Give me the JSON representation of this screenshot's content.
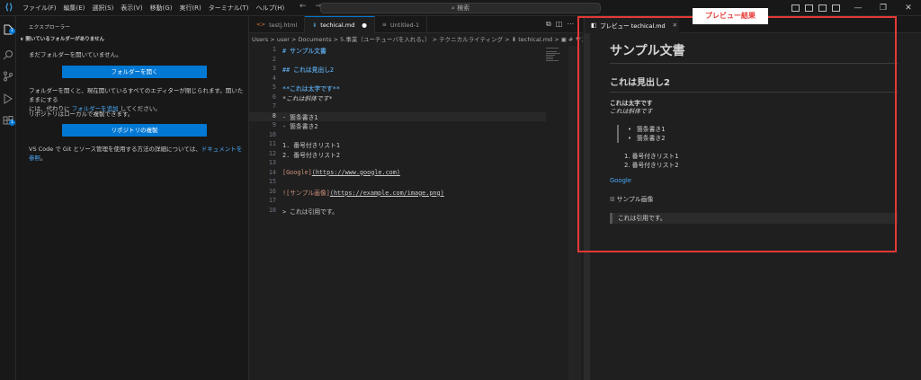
{
  "titlebar": {
    "menu": [
      "ファイル(F)",
      "編集(E)",
      "選択(S)",
      "表示(V)",
      "移動(G)",
      "実行(R)",
      "ターミナル(T)",
      "ヘルプ(H)"
    ],
    "search_placeholder": "検索"
  },
  "sidebar": {
    "header": "エクスプローラー",
    "section_title": "開いているフォルダーがありません",
    "no_folder_text": "まだフォルダーを開いていません。",
    "open_folder_button": "フォルダーを開く",
    "open_folder_desc_1": "フォルダーを開くと、現在開いているすべてのエディターが閉じられます。開いたままにする",
    "open_folder_desc_2a": "には、代わりに ",
    "open_folder_desc_2_link": "フォルダーを追加",
    "open_folder_desc_2b": " してください。",
    "clone_text": "リポジトリはローカルで複製できます。",
    "clone_button": "リポジトリの複製",
    "git_text_a": "VS Code で Git とソース管理を使用する方法の詳細については、",
    "git_text_link": "ドキュメントを参照",
    "git_text_b": "。"
  },
  "tabs": [
    {
      "label": "testj.html",
      "active": false
    },
    {
      "label": "techical.md",
      "active": true,
      "dirty_marker": "●"
    },
    {
      "label": "Untitled-1",
      "active": false
    }
  ],
  "breadcrumb": "Users > user > Documents > 5.事業（ユーチューバを入れる。） > テクニカルライティング > ⬇ techical.md > ▣ # サンプル文書",
  "editor": {
    "lines": [
      {
        "n": "1",
        "t": "# サンプル文書"
      },
      {
        "n": "2",
        "t": ""
      },
      {
        "n": "3",
        "t": "## これは見出し2"
      },
      {
        "n": "4",
        "t": ""
      },
      {
        "n": "5",
        "t": "**これは太字です**"
      },
      {
        "n": "6",
        "t": "*これは斜体です*"
      },
      {
        "n": "7",
        "t": ""
      },
      {
        "n": "8",
        "t": "- 箇条書き1"
      },
      {
        "n": "9",
        "t": "- 箇条書き2"
      },
      {
        "n": "10",
        "t": ""
      },
      {
        "n": "11",
        "t": "1. 番号付きリスト1"
      },
      {
        "n": "12",
        "t": "2. 番号付きリスト2"
      },
      {
        "n": "13",
        "t": ""
      },
      {
        "n": "14",
        "t_link": "[Google]",
        "t_url": "(https://www.google.com)"
      },
      {
        "n": "15",
        "t": ""
      },
      {
        "n": "16",
        "t_link": "![サンプル画像]",
        "t_url": "(https://example.com/image.png)"
      },
      {
        "n": "17",
        "t": ""
      },
      {
        "n": "18",
        "t": "> これは引用です。"
      }
    ]
  },
  "preview": {
    "tab_label": "プレビュー techical.md",
    "h1": "サンプル文書",
    "h2": "これは見出し2",
    "bold": "これは太字です",
    "italic": "これは斜体です",
    "bullets": [
      "箇条書き1",
      "箇条書き2"
    ],
    "numbered": [
      "番号付きリスト1",
      "番号付きリスト2"
    ],
    "link": "Google",
    "image_alt": "サンプル画像",
    "quote": "これは引用です。"
  },
  "annotation": {
    "label": "プレビュー結果",
    "color": "#e53935"
  },
  "colors": {
    "accent": "#0078d4",
    "link": "#4daafc"
  }
}
